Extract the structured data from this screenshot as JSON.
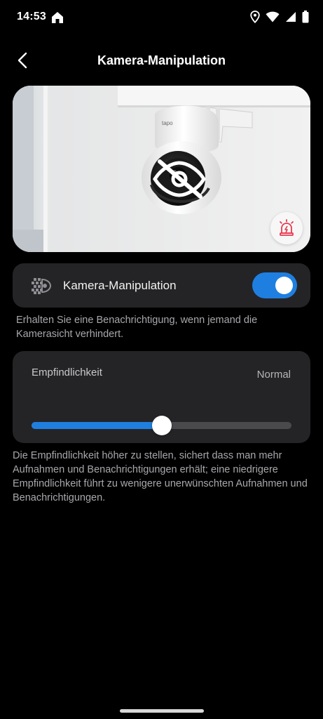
{
  "status_bar": {
    "time": "14:53",
    "icons": [
      "home-icon",
      "location-icon",
      "wifi-icon",
      "signal-icon",
      "battery-icon"
    ]
  },
  "header": {
    "title": "Kamera-Manipulation",
    "back_icon": "chevron-left-icon"
  },
  "preview": {
    "brand_text": "tapo",
    "privacy_icon": "eye-off-icon",
    "alarm_icon": "siren-icon",
    "alarm_color": "#e8384f"
  },
  "tamper_toggle": {
    "label": "Kamera-Manipulation",
    "enabled": true,
    "icon": "tamper-detection-icon",
    "accent": "#1f7fe0"
  },
  "tamper_description": "Erhalten Sie eine Benachrichtigung, wenn jemand die Kamerasicht verhindert.",
  "sensitivity": {
    "label": "Empfindlichkeit",
    "value_text": "Normal",
    "level": 0.5
  },
  "sensitivity_description": "Die Empfindlichkeit höher zu stellen, sichert dass man mehr Aufnahmen und Benachrichtigungen erhält; eine niedrigere Empfindlichkeit führt zu wenigere unerwünschten Aufnahmen und Benachrichtigungen."
}
